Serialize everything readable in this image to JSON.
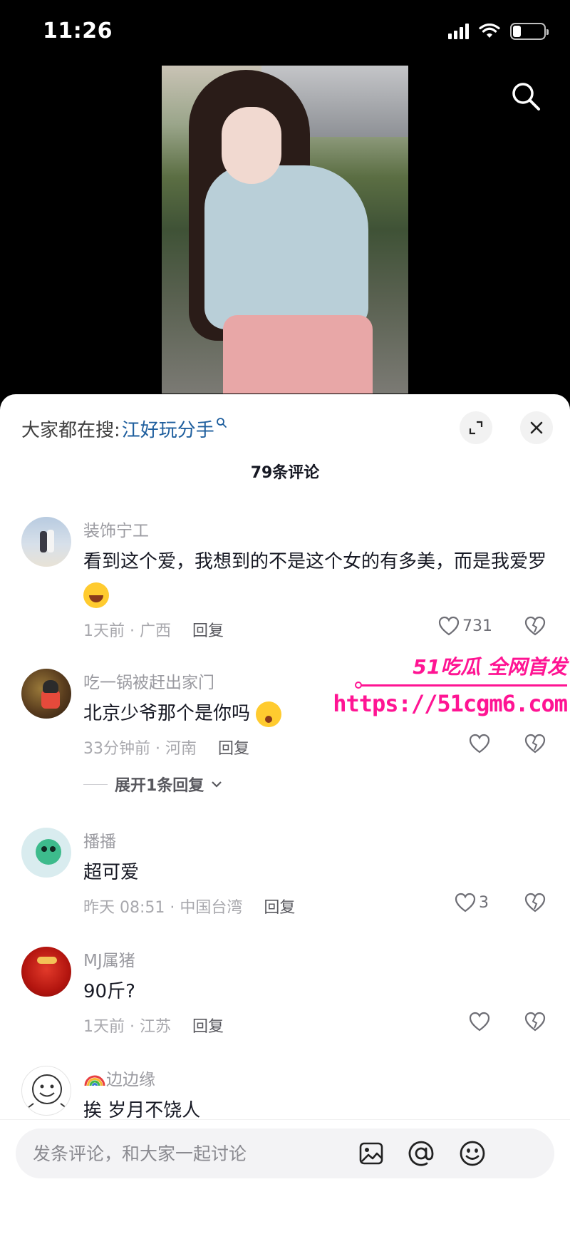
{
  "status_bar": {
    "time": "11:26",
    "battery_level": 0.25
  },
  "video": {
    "search_icon": "search-icon"
  },
  "panel": {
    "suggest_label": "大家都在搜:",
    "suggest_term": "江好玩分手",
    "comment_count": "79条评论"
  },
  "comments": [
    {
      "name": "装饰宁工",
      "text": "看到这个爱，我想到的不是这个女的有多美，而是我爱罗",
      "time": "1天前 · 广西",
      "reply": "回复",
      "likes": "731"
    },
    {
      "name": "吃一锅被赶出家门",
      "text": "北京少爷那个是你吗",
      "time": "33分钟前 · 河南",
      "reply": "回复",
      "likes": "",
      "expand": "展开1条回复"
    },
    {
      "name": "播播",
      "text": "超可爱",
      "time": "昨天 08:51 · 中国台湾",
      "reply": "回复",
      "likes": "3"
    },
    {
      "name": "MJ属猪",
      "text": "90斤?",
      "time": "1天前 · 江苏",
      "reply": "回复",
      "likes": ""
    },
    {
      "name": "边边缘",
      "text": "挨 岁月不饶人"
    }
  ],
  "watermark": {
    "brand": "51吃瓜 全网首发",
    "url": "https://51cgm6.com"
  },
  "input": {
    "placeholder": "发条评论，和大家一起讨论"
  },
  "colors": {
    "link": "#1f5f9e",
    "watermark": "#ff1493"
  }
}
